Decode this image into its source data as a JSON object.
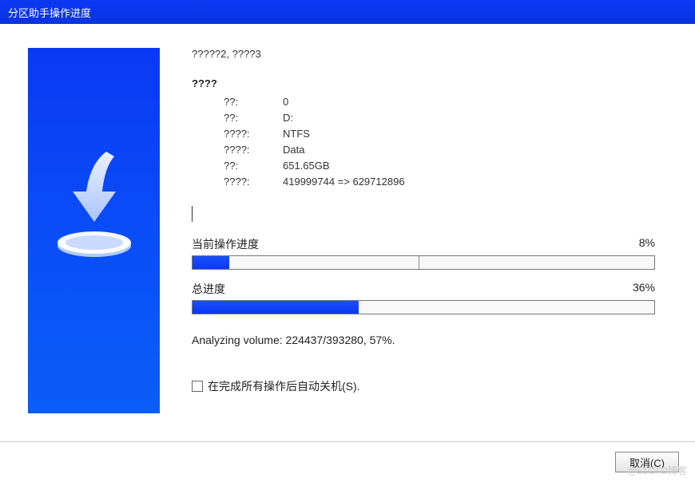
{
  "window": {
    "title": "分区助手操作进度"
  },
  "operation": "?????2, ????3",
  "details_title": "????",
  "details": [
    {
      "label": "??:",
      "value": "0"
    },
    {
      "label": "??:",
      "value": "D:"
    },
    {
      "label": "????:",
      "value": "NTFS"
    },
    {
      "label": "????:",
      "value": "Data"
    },
    {
      "label": "??:",
      "value": "651.65GB"
    },
    {
      "label": "????:",
      "value": "419999744 => 629712896"
    }
  ],
  "current_progress": {
    "label": "当前操作进度",
    "percent_text": "8%",
    "percent": 8
  },
  "total_progress": {
    "label": "总进度",
    "percent_text": "36%",
    "percent": 36
  },
  "status": "Analyzing volume: 224437/393280, 57%.",
  "checkbox": {
    "label": "在完成所有操作后自动关机(S).",
    "checked": false
  },
  "buttons": {
    "cancel": "取消(C)"
  },
  "watermark": "@51CTO博客"
}
